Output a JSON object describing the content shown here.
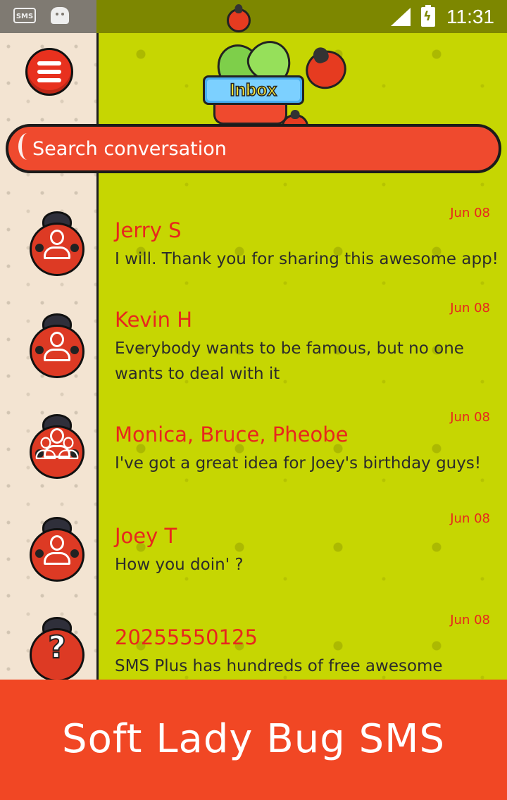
{
  "status_bar": {
    "notification_icons": [
      "sms-icon",
      "android-icon"
    ],
    "right_icons": [
      "signal-icon",
      "battery-charging-icon"
    ],
    "time": "11:31"
  },
  "header": {
    "menu_icon": "hamburger-menu-icon",
    "badge_label": "Inbox"
  },
  "search": {
    "placeholder": "Search conversation"
  },
  "conversations": [
    {
      "name": "Jerry S",
      "message": "I will. Thank you for sharing this awesome app!",
      "date": "Jun 08",
      "avatar": "single-contact-ladybug-icon"
    },
    {
      "name": "Kevin H",
      "message": "Everybody wants to be famous, but no one wants to deal with it",
      "date": "Jun 08",
      "avatar": "single-contact-ladybug-icon"
    },
    {
      "name": "Monica, Bruce, Pheobe",
      "message": "I've got a great idea for Joey's birthday guys!",
      "date": "Jun 08",
      "avatar": "group-contact-ladybug-icon"
    },
    {
      "name": "Joey T",
      "message": "How you doin' ?",
      "date": "Jun 08",
      "avatar": "single-contact-ladybug-icon"
    },
    {
      "name": "20255550125",
      "message": "SMS Plus has hundreds of free awesome themes",
      "date": "Jun 08",
      "avatar": "unknown-contact-ladybug-icon",
      "avatar_glyph": "?"
    }
  ],
  "footer": {
    "title": "Soft Lady Bug SMS"
  },
  "colors": {
    "main_background": "#c6d602",
    "accent_red": "#ef4a2e",
    "name_red": "#e8261d",
    "footer_orange": "#f14724",
    "left_strip": "#f3e4d2"
  }
}
